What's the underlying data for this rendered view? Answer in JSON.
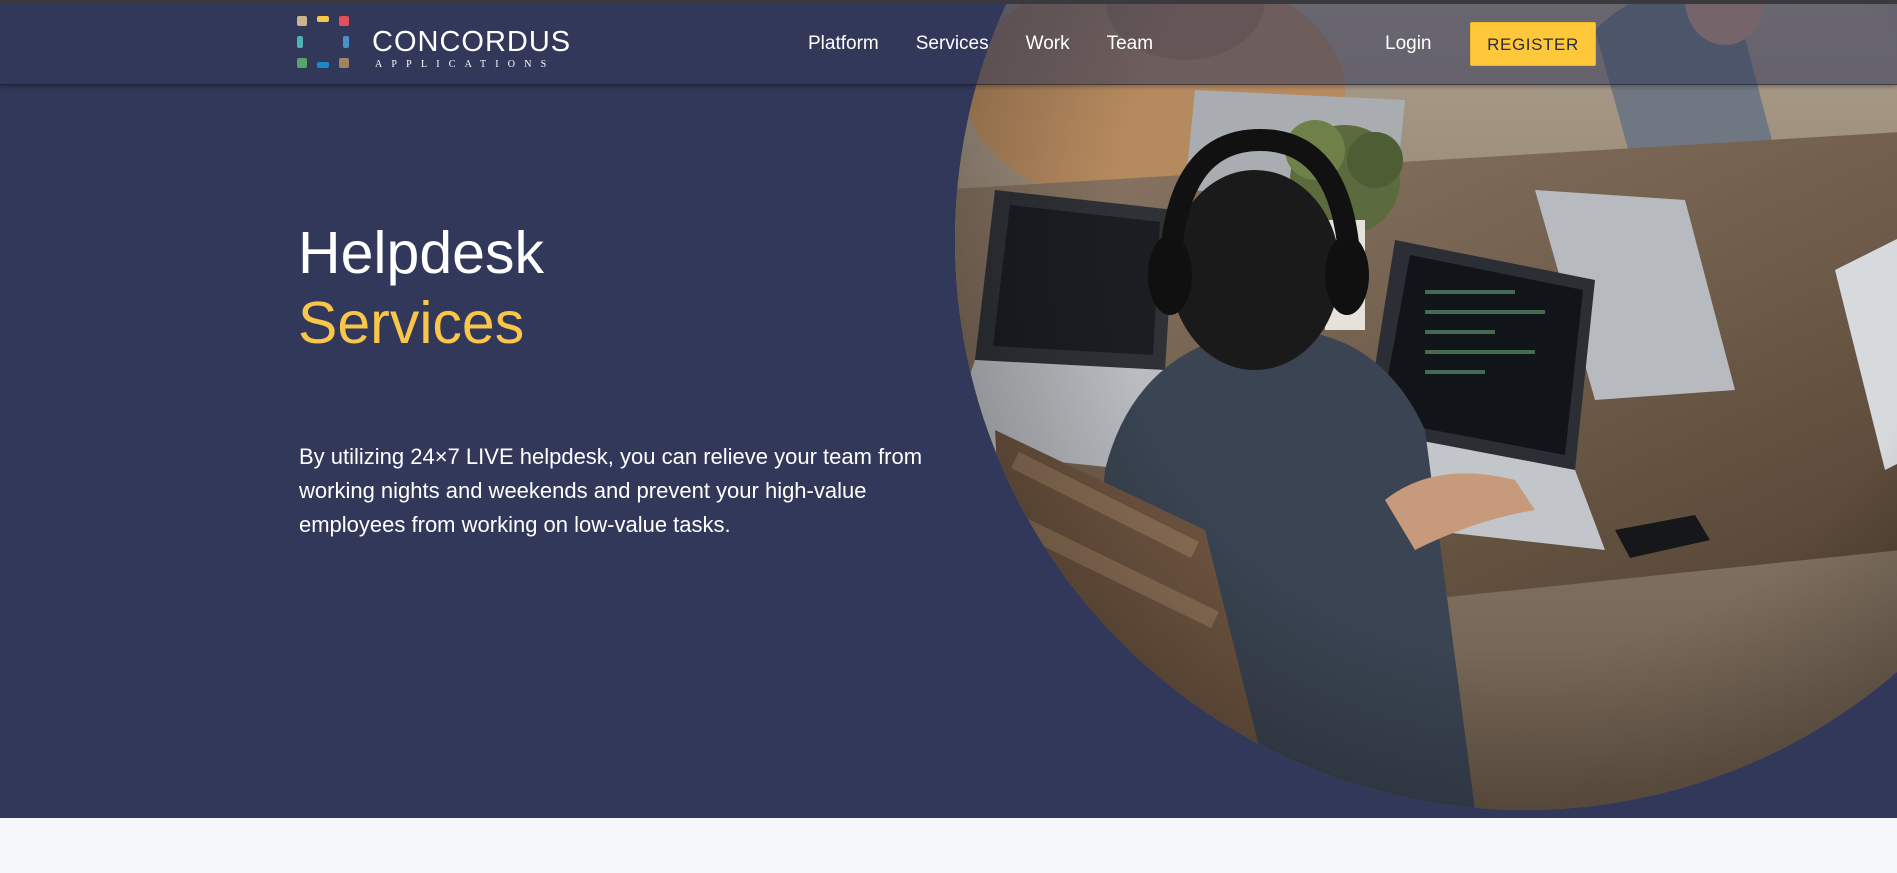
{
  "brand": {
    "name": "CONCORDUS",
    "sub": "APPLICATIONS",
    "logo_colors": [
      "#c9b58d",
      "#f2c94c",
      "#e2505b",
      "#4a90c9",
      "#5aa36b",
      "#1b89c8",
      "#a0835f",
      "#4fb2b2"
    ]
  },
  "nav": {
    "items": [
      {
        "label": "Platform"
      },
      {
        "label": "Services"
      },
      {
        "label": "Work"
      },
      {
        "label": "Team"
      }
    ],
    "login_label": "Login",
    "register_label": "REGISTER"
  },
  "hero": {
    "title_line1": "Helpdesk",
    "title_line2": "Services",
    "description": "By utilizing 24×7 LIVE helpdesk, you can relieve your team from working nights and weekends and prevent your high-value employees from working on low-value tasks.",
    "photo_icon": "team-working-on-laptops-photo"
  },
  "colors": {
    "hero_bg": "#31385a",
    "accent": "#f9c64a",
    "button": "#ffc73a",
    "page_bg": "#f6f7fb"
  }
}
